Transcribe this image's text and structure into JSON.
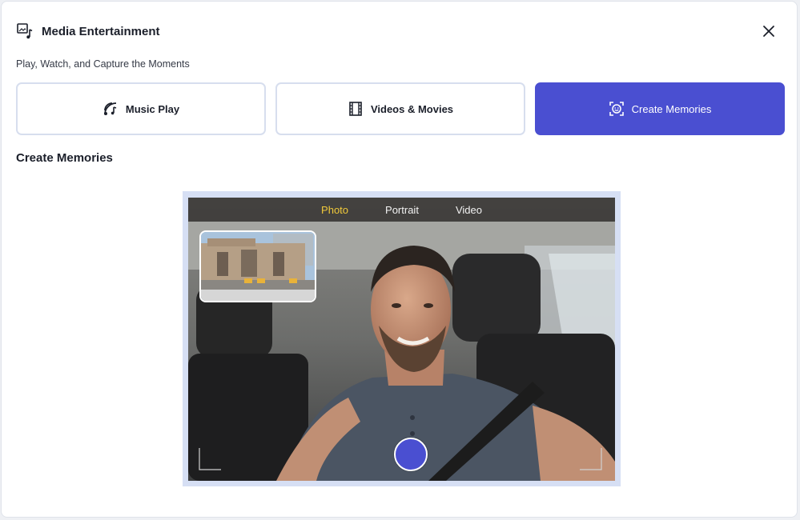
{
  "header": {
    "title": "Media Entertainment",
    "subtitle": "Play, Watch, and Capture the Moments",
    "icon": "media-music-icon",
    "close_icon": "close-icon"
  },
  "tabs": [
    {
      "label": "Music Play",
      "icon": "signal-music-icon",
      "active": false
    },
    {
      "label": "Videos & Movies",
      "icon": "film-strip-icon",
      "active": false
    },
    {
      "label": "Create Memories",
      "icon": "face-scan-icon",
      "active": true
    }
  ],
  "section": {
    "title": "Create Memories"
  },
  "camera": {
    "modes": [
      {
        "label": "Photo",
        "active": true
      },
      {
        "label": "Portrait",
        "active": false
      },
      {
        "label": "Video",
        "active": false
      }
    ],
    "pip_image": "train-station-building",
    "main_image": "man-selfie-in-car",
    "shutter_icon": "shutter-button"
  },
  "colors": {
    "accent": "#4a4fd1",
    "active_mode": "#f0c93a",
    "tab_border": "#d7deee",
    "viewer_frame": "#d6dff4"
  }
}
